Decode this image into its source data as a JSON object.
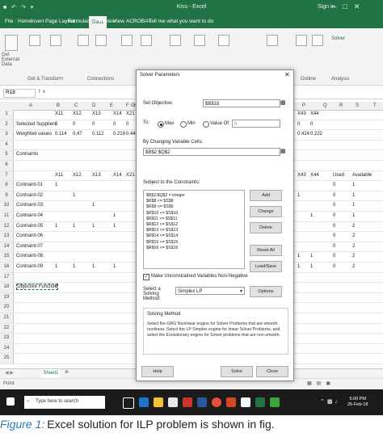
{
  "window": {
    "title": "Kiss - Excel",
    "user": "Sign in"
  },
  "ribbon_tabs": [
    "File",
    "Home",
    "Insert",
    "Page Layout",
    "Formulas",
    "Data",
    "Review",
    "View",
    "ACROBAT",
    "Tell me what you want to do"
  ],
  "ribbon": {
    "group_labels": [
      "Get & Transform",
      "Connections",
      "Outline",
      "Analysis"
    ],
    "analysis_button": "Solver",
    "get_data_label": "Get External Data"
  },
  "formula_bar": {
    "name_box": "R18",
    "fx": "fx"
  },
  "columns": [
    "A",
    "B",
    "C",
    "D",
    "E",
    "F",
    "G",
    "H",
    "P",
    "Q",
    "R",
    "S",
    "T"
  ],
  "rows": [
    {
      "n": "1",
      "a": "",
      "vals": [
        "X11",
        "X12",
        "X13",
        "X14",
        "X21"
      ],
      "right": [
        "X43",
        "X44"
      ]
    },
    {
      "n": "2",
      "a": "Selected Suppliers",
      "vals": [
        "0",
        "0",
        "0",
        "0",
        "0"
      ],
      "right": [
        "0",
        "0"
      ]
    },
    {
      "n": "3",
      "a": "Weighted values",
      "vals": [
        "0.114",
        "0.47",
        "0.112",
        "0.219",
        "0.44"
      ],
      "right": [
        "0.424",
        "0.222"
      ]
    },
    {
      "n": "4",
      "a": "",
      "vals": [],
      "right": []
    },
    {
      "n": "5",
      "a": "Contraints",
      "vals": [],
      "right": []
    },
    {
      "n": "6",
      "a": "",
      "vals": [],
      "right": []
    },
    {
      "n": "7",
      "a": "",
      "vals": [
        "X11",
        "X12",
        "X13",
        "X14",
        "X21"
      ],
      "right": [
        "X43",
        "X44",
        "Used",
        "Available"
      ]
    },
    {
      "n": "8",
      "a": "Contraint-01",
      "vals": [
        "1"
      ],
      "right": [
        "",
        "",
        "0",
        "1"
      ]
    },
    {
      "n": "9",
      "a": "Contraint-02",
      "vals": [
        "",
        "1"
      ],
      "right": [
        "1",
        "",
        "0",
        "1"
      ]
    },
    {
      "n": "10",
      "a": "Contraint-03",
      "vals": [
        "",
        "",
        "1"
      ],
      "right": [
        "",
        "",
        "0",
        "1"
      ]
    },
    {
      "n": "11",
      "a": "Contraint-04",
      "vals": [
        "",
        "",
        "",
        "1"
      ],
      "right": [
        "",
        "1",
        "0",
        "1"
      ]
    },
    {
      "n": "12",
      "a": "Contraint-05",
      "vals": [
        "1",
        "1",
        "1",
        "1"
      ],
      "right": [
        "",
        "",
        "0",
        "2"
      ]
    },
    {
      "n": "13",
      "a": "Contraint-06",
      "vals": [],
      "right": [
        "",
        "",
        "0",
        "2"
      ]
    },
    {
      "n": "14",
      "a": "Contraint-07",
      "vals": [],
      "right": [
        "",
        "",
        "0",
        "2"
      ]
    },
    {
      "n": "15",
      "a": "Contraint-08",
      "vals": [],
      "right": [
        "1",
        "1",
        "0",
        "2"
      ]
    },
    {
      "n": "16",
      "a": "Contraint-09",
      "vals": [
        "1",
        "1",
        "1",
        "1"
      ],
      "right": [
        "1",
        "1",
        "0",
        "2"
      ]
    },
    {
      "n": "17",
      "a": "",
      "vals": [],
      "right": []
    },
    {
      "n": "18",
      "a": "Objective Function",
      "vals": [
        "0"
      ],
      "right": []
    },
    {
      "n": "19",
      "a": "",
      "vals": [],
      "right": []
    },
    {
      "n": "20",
      "a": "",
      "vals": [],
      "right": []
    },
    {
      "n": "21",
      "a": "",
      "vals": [],
      "right": []
    },
    {
      "n": "22",
      "a": "",
      "vals": [],
      "right": []
    },
    {
      "n": "23",
      "a": "",
      "vals": [],
      "right": []
    },
    {
      "n": "24",
      "a": "",
      "vals": [],
      "right": []
    },
    {
      "n": "25",
      "a": "",
      "vals": [],
      "right": []
    }
  ],
  "sheet_tab": "Sheet1",
  "status": "Point",
  "solver": {
    "title": "Solver Parameters",
    "set_objective_label": "Set Objective:",
    "set_objective_value": "$B$18",
    "to_label": "To:",
    "max_label": "Max",
    "min_label": "Min",
    "value_of_label": "Value Of:",
    "value_of_value": "0",
    "changing_label": "By Changing Variable Cells:",
    "changing_value": "$B$2:$Q$2",
    "subject_label": "Subject to the Constraints:",
    "constraints": [
      "$B$2:$Q$2 = integer",
      "$R$8 <= $S$8",
      "$R$9 <= $S$9",
      "$R$10 <= $S$10",
      "$R$11 <= $S$11",
      "$R$12 <= $S$12",
      "$R$13 <= $S$13",
      "$R$14 <= $S$14",
      "$R$15 <= $S$15",
      "$R$16 <= $S$16"
    ],
    "add": "Add",
    "change": "Change",
    "delete": "Delete",
    "reset_all": "Reset All",
    "load_save": "Load/Save",
    "nonneg_label": "Make Unconstrained Variables Non-Negative",
    "method_label": "Select a Solving Method:",
    "method_value": "Simplex LP",
    "options": "Options",
    "group_title": "Solving Method",
    "group_text": "Select the GRG Nonlinear engine for Solver Problems that are smooth nonlinear. Select the LP Simplex engine for linear Solver Problems, and select the Evolutionary engine for Solver problems that are non-smooth.",
    "help": "Help",
    "solve": "Solve",
    "close": "Close"
  },
  "taskbar": {
    "search_placeholder": "Type here to search",
    "time": "5:00 PM",
    "date": "26-Feb-18"
  },
  "caption": {
    "fig": "Figure 1:",
    "text": "Excel solution for ILP problem is shown in fig."
  }
}
